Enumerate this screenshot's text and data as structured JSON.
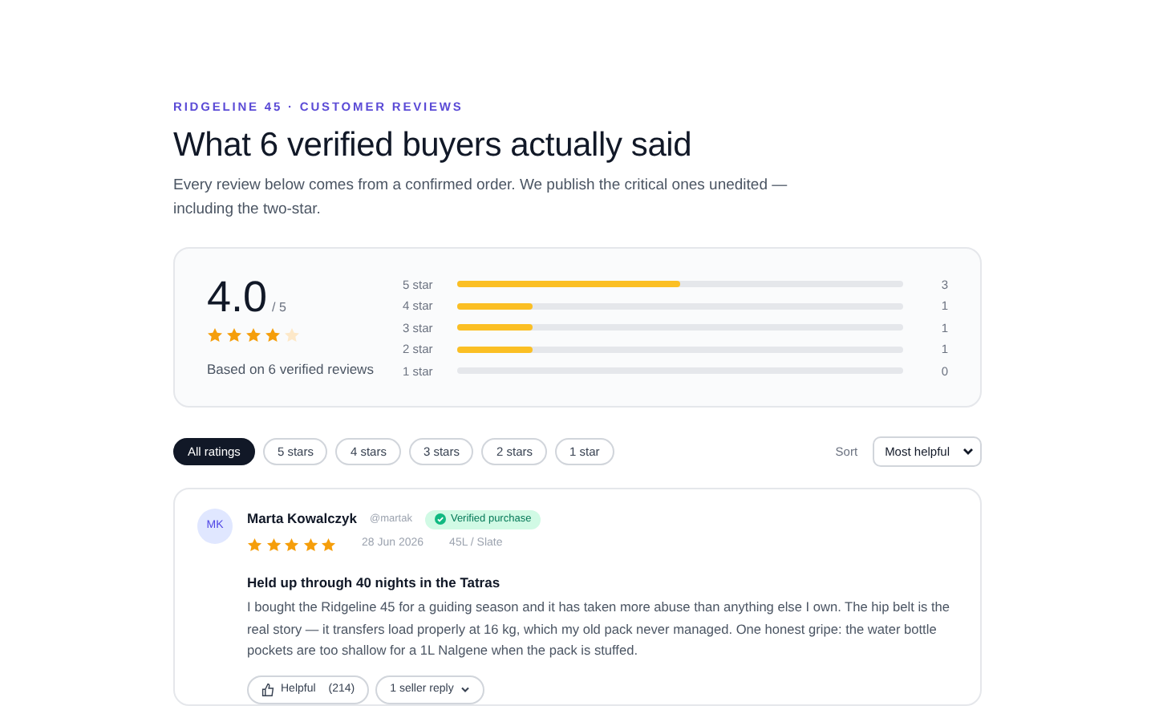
{
  "eyebrow": "RIDGELINE 45 · CUSTOMER REVIEWS",
  "title": "What 6 verified buyers actually said",
  "intro": "Every review below comes from a confirmed order. We publish the critical ones unedited — including the two-star.",
  "summary": {
    "score": "4.0",
    "out_of": "/ 5",
    "stars": 4,
    "based_on": "Based on 6 verified reviews",
    "bars": [
      {
        "label": "5 star",
        "level": 0.5,
        "count": "3"
      },
      {
        "label": "4 star",
        "level": 0.17,
        "count": "1"
      },
      {
        "label": "3 star",
        "level": 0.17,
        "count": "1"
      },
      {
        "label": "2 star",
        "level": 0.17,
        "count": "1"
      },
      {
        "label": "1 star",
        "count": "0"
      }
    ]
  },
  "filters": [
    {
      "label": "All ratings",
      "selected": true
    },
    {
      "label": "5 stars",
      "selected": false
    },
    {
      "label": "4 stars",
      "selected": false
    },
    {
      "label": "3 stars",
      "selected": false
    },
    {
      "label": "2 stars",
      "selected": false
    },
    {
      "label": "1 star",
      "selected": false
    }
  ],
  "sort": {
    "label": "Sort",
    "value": "Most helpful"
  },
  "reviews": [
    {
      "initials": "MK",
      "name": "Marta Kowalczyk",
      "handle": "@martak",
      "verified": true,
      "verified_label": "Verified purchase",
      "stars": 5,
      "date": "28 Jun 2026",
      "variant": "45L / Slate",
      "headline": "Held up through 40 nights in the Tatras",
      "body": "I bought the Ridgeline 45 for a guiding season and it has taken more abuse than anything else I own. The hip belt is the real story — it transfers load properly at 16 kg, which my old pack never managed. One honest gripe: the water bottle pockets are too shallow for a 1L Nalgene when the pack is stuffed.",
      "helpful": "Helpful",
      "helpful_count": "(214)",
      "replies": "1 seller reply"
    }
  ]
}
